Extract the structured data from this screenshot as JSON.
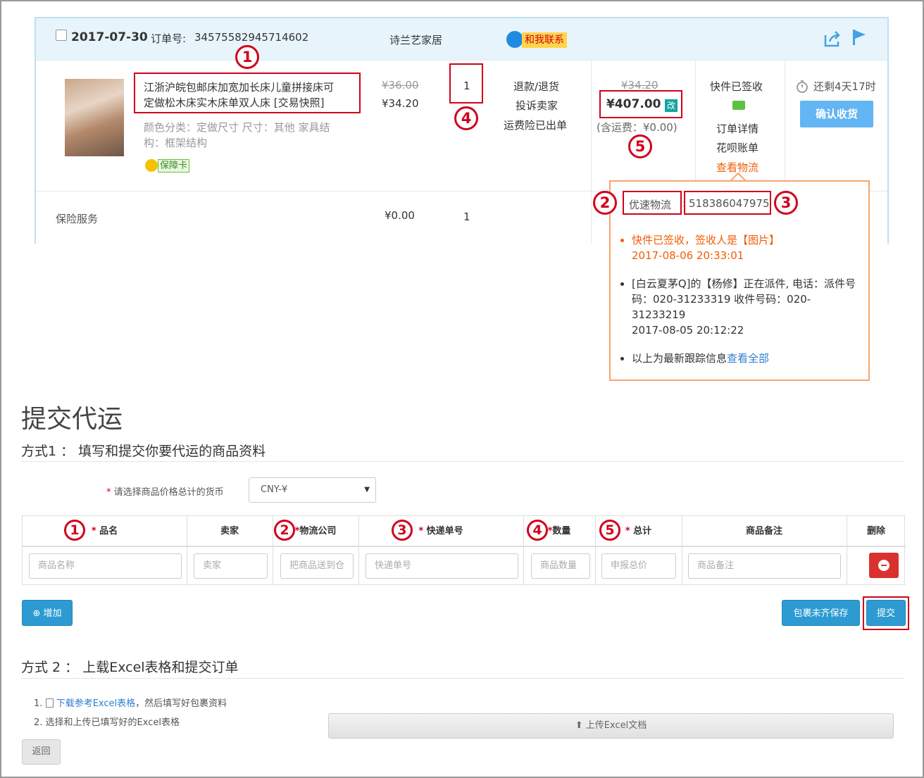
{
  "order": {
    "date": "2017-07-30",
    "order_no_label": "订单号:",
    "order_no": "3457558294571460​2",
    "shop": "诗兰艺家居",
    "contact": "和我联系",
    "product_title_line1": "江浙沪皖包邮床加宽加长床儿童拼接床可",
    "product_title_line2": "定做松木床实木床单双人床 [交易快照]",
    "attrs_line1": "颜色分类：定做尺寸  尺寸：其他  家具结",
    "attrs_line2": "构：框架结构",
    "guarantee": "保障卡",
    "orig_price": "¥36.00",
    "price": "¥34.20",
    "qty": "1",
    "actions": [
      "退款/退货",
      "投诉卖家",
      "运费险已出单"
    ],
    "total_strike": "¥34.20",
    "total": "¥407.00",
    "total_badge": "改",
    "shipping_note": "(含运费：¥0.00)",
    "status": [
      "快件已签收",
      "订单详情",
      "花呗账单"
    ],
    "view_logistics": "查看物流",
    "countdown": "还剩4天17时",
    "confirm_btn": "确认收货",
    "insurance_label": "保险服务",
    "insurance_price": "¥0.00",
    "insurance_qty": "1"
  },
  "popover": {
    "carrier": "优速物流",
    "separator": ":",
    "tracking_no": "518386047975",
    "items": [
      {
        "text": "快件已签收，签收人是【图片】",
        "time": "2017-08-06 20:33:01"
      },
      {
        "text": "[白云夏茅Q]的【杨修】正在派件, 电话：派件号码：020-31233319 收件号码：020-31233219",
        "time": "2017-08-05 20:12:22"
      },
      {
        "text": "以上为最新跟踪信息",
        "link": "查看全部"
      }
    ]
  },
  "markers": {
    "one": "1",
    "two": "2",
    "three": "3",
    "four": "4",
    "five": "5"
  },
  "form": {
    "title": "提交代运",
    "method1": "方式1 ： 填写和提交你要代运的商品资料",
    "currency_label": "请选择商品价格总计的货币",
    "currency_value": "CNY-¥",
    "required_mark": "*",
    "columns": [
      "品名",
      "卖家",
      "物流公司",
      "快递单号",
      "数量",
      "总计",
      "商品备注",
      "删除"
    ],
    "placeholders": [
      "商品名称",
      "卖家",
      "把商品送到仓",
      "快递单号",
      "商品数量",
      "申报总价",
      "商品备注"
    ],
    "add_btn": "增加",
    "save_btn": "包裹未齐保存",
    "submit_btn": "提交",
    "method2": "方式 2 ： 上载Excel表格和提交订单",
    "step1_num": "1.",
    "step1_link": "下载参考Excel表格",
    "step1_rest": "，然后填写好包裹资料",
    "step2": "2. 选择和上传已填写好的Excel表格",
    "upload_btn": "上传Excel文档",
    "back_btn": "返回"
  }
}
